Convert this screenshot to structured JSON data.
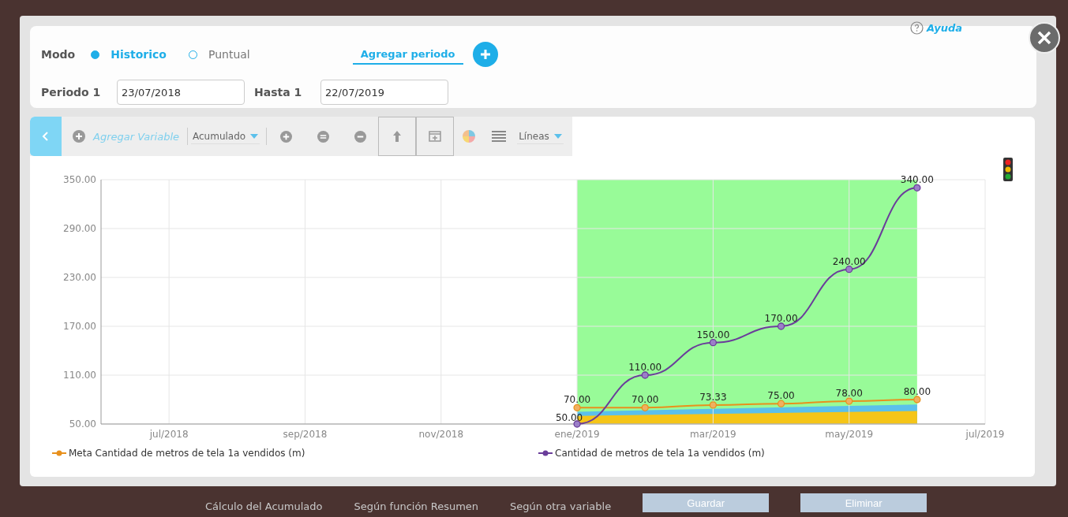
{
  "header": {
    "mode_label": "Modo",
    "modes": [
      {
        "label": "Historico",
        "selected": true
      },
      {
        "label": "Puntual",
        "selected": false
      }
    ],
    "add_period": "Agregar periodo",
    "help": "Ayuda",
    "period_label": "Periodo 1",
    "period_from": "23/07/2018",
    "until_label": "Hasta 1",
    "period_to": "22/07/2019"
  },
  "toolbar": {
    "add_variable": "Agregar Variable",
    "accumulation": "Acumulado",
    "chart_type": "Líneas"
  },
  "chart": {
    "chart_data": {
      "type": "line",
      "grid": true,
      "categories": [
        "jul/2018",
        null,
        "sep/2018",
        null,
        "nov/2018",
        null,
        "ene/2019",
        null,
        "mar/2019",
        null,
        "may/2019",
        null,
        "jul/2019"
      ],
      "ylim": [
        50,
        350
      ],
      "yticks": [
        {
          "value": 50,
          "label": "50.00"
        },
        {
          "value": 110,
          "label": "110.00"
        },
        {
          "value": 170,
          "label": "170.00"
        },
        {
          "value": 230,
          "label": "230.00"
        },
        {
          "value": 290,
          "label": "290.00"
        },
        {
          "value": 350,
          "label": "350.00"
        }
      ],
      "series": [
        {
          "name": "Meta Cantidad de metros de tela 1a vendidos (m)",
          "color": "#e8901c",
          "marker": "circle",
          "values": [
            null,
            null,
            null,
            null,
            null,
            null,
            70,
            70,
            73.33,
            75,
            78,
            80,
            null
          ]
        },
        {
          "name": "Cantidad de metros de tela 1a vendidos (m)",
          "color": "#6a3d9a",
          "marker": "circle",
          "values": [
            null,
            null,
            null,
            null,
            null,
            null,
            50,
            110,
            150,
            170,
            240,
            340,
            null
          ]
        }
      ],
      "value_labels": [
        [
          null,
          null,
          null,
          null,
          null,
          null,
          "70.00",
          "70.00",
          "73.33",
          "75.00",
          "78.00",
          "80.00",
          null
        ],
        [
          null,
          null,
          null,
          null,
          null,
          null,
          "50.00",
          "110.00",
          "150.00",
          "170.00",
          "240.00",
          "340.00",
          null
        ]
      ]
    }
  },
  "background_page": {
    "texts": [
      "Cálculo del Acumulado",
      "Según función Resumen",
      "Según otra variable"
    ],
    "buttons": [
      "Guardar",
      "Eliminar"
    ]
  }
}
